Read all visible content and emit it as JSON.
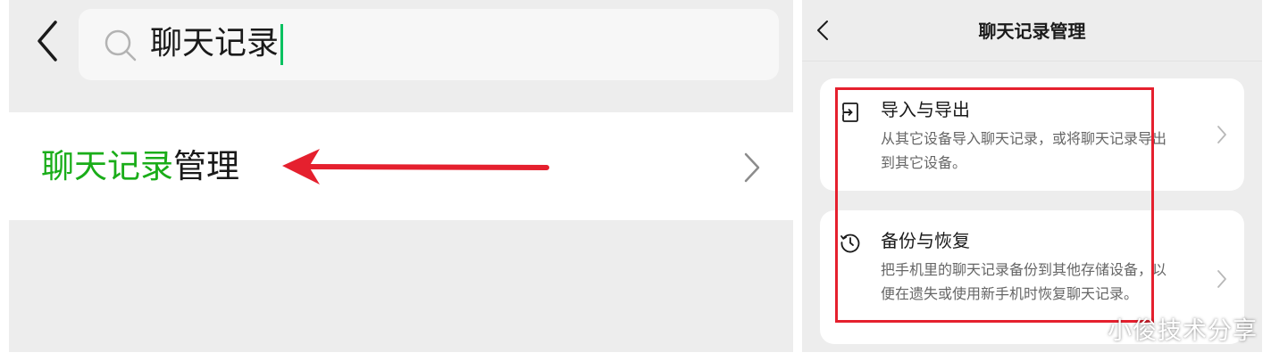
{
  "left": {
    "search": {
      "query": "聊天记录"
    },
    "result": {
      "highlight": "聊天记录",
      "rest": "管理"
    }
  },
  "right": {
    "title": "聊天记录管理",
    "cards": [
      {
        "title": "导入与导出",
        "description": "从其它设备导入聊天记录，或将聊天记录导出到其它设备。"
      },
      {
        "title": "备份与恢复",
        "description": "把手机里的聊天记录备份到其他存储设备，以便在遗失或使用新手机时恢复聊天记录。"
      }
    ]
  },
  "watermark": "小俊技术分享",
  "colors": {
    "accent_green": "#07c160",
    "highlight_red": "#e5202e",
    "background": "#ededed"
  },
  "icons": [
    "back-arrow-icon",
    "search-icon",
    "chevron-right-icon",
    "import-export-icon",
    "history-icon",
    "red-arrow-annotation"
  ]
}
